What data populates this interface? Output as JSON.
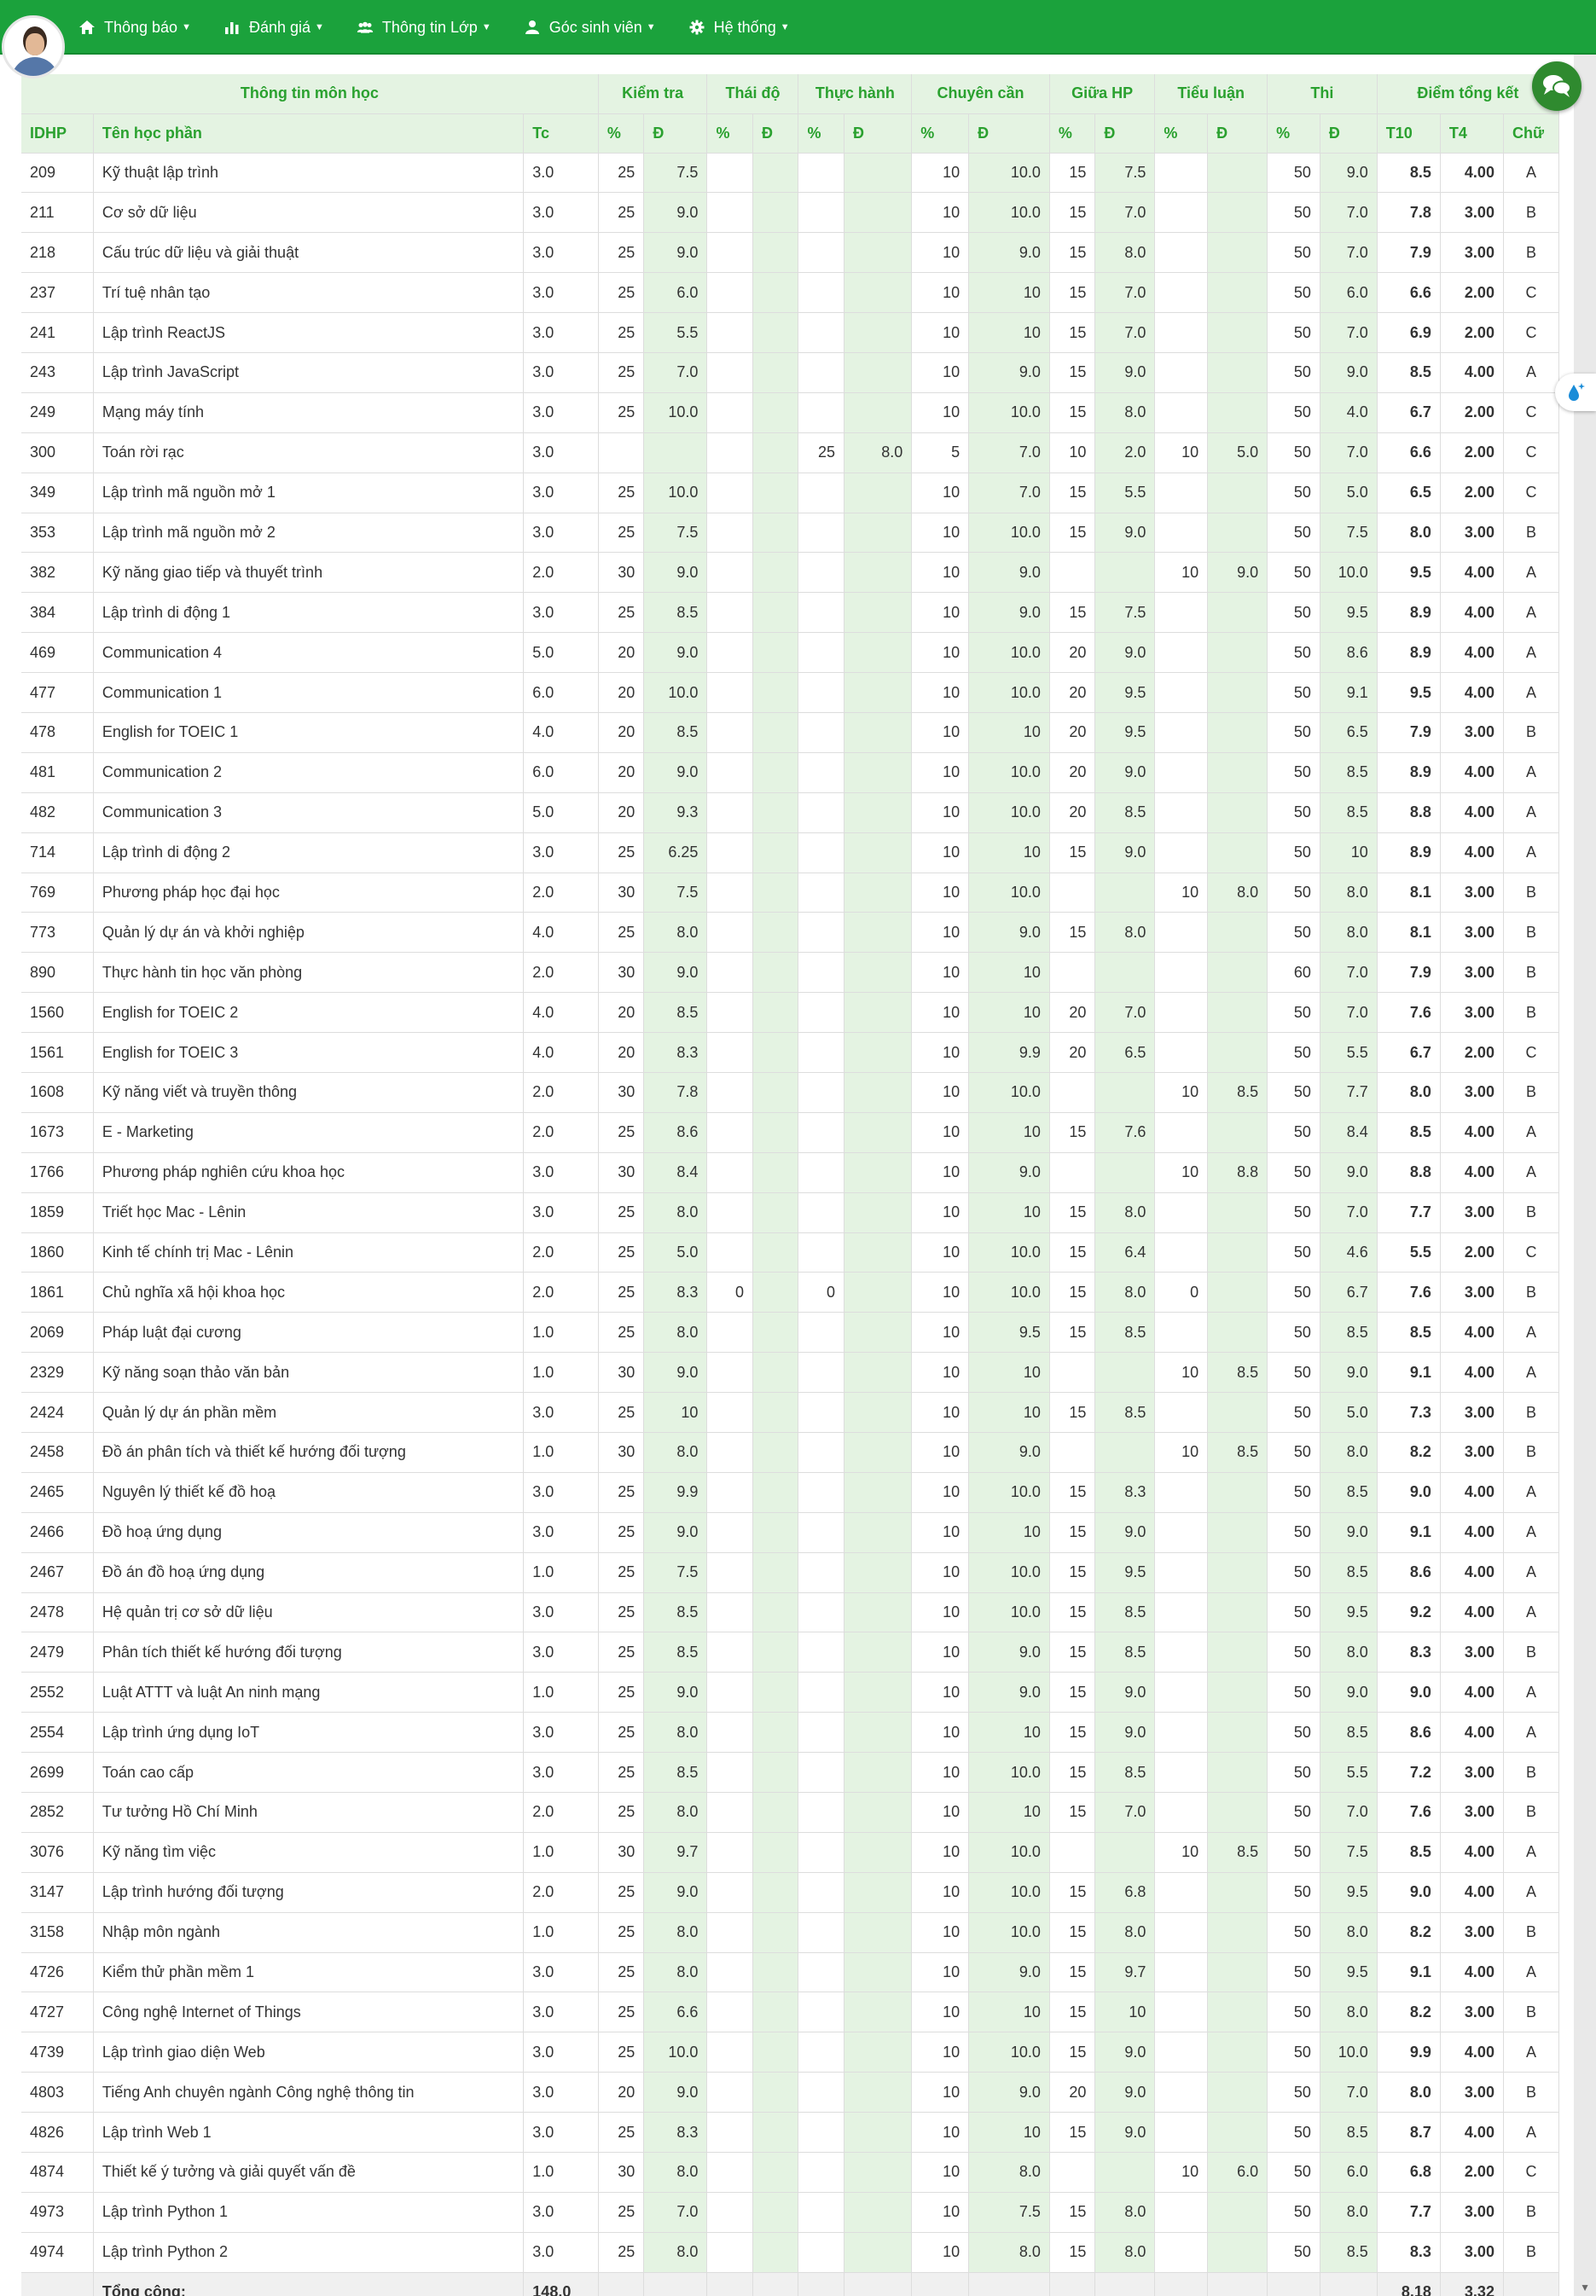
{
  "nav": {
    "items": [
      {
        "label": "Thông báo",
        "icon": "home-icon"
      },
      {
        "label": "Đánh giá",
        "icon": "bar-chart-icon"
      },
      {
        "label": "Thông tin Lớp",
        "icon": "users-icon"
      },
      {
        "label": "Góc sinh viên",
        "icon": "user-icon"
      },
      {
        "label": "Hệ thống",
        "icon": "gear-icon"
      }
    ]
  },
  "table": {
    "groups": [
      "Thông tin môn học",
      "Kiểm tra",
      "Thái độ",
      "Thực hành",
      "Chuyên cần",
      "Giữa HP",
      "Tiểu luận",
      "Thi",
      "Điểm tổng kết"
    ],
    "columns": [
      "IDHP",
      "Tên học phần",
      "Tc",
      "%",
      "Đ",
      "%",
      "Đ",
      "%",
      "Đ",
      "%",
      "Đ",
      "%",
      "Đ",
      "%",
      "Đ",
      "%",
      "Đ",
      "T10",
      "T4",
      "Chữ"
    ],
    "rows": [
      [
        "209",
        "Kỹ thuật lập trình",
        "3.0",
        "25",
        "7.5",
        "",
        "",
        "",
        "",
        "10",
        "10.0",
        "15",
        "7.5",
        "",
        "",
        "50",
        "9.0",
        "8.5",
        "4.00",
        "A"
      ],
      [
        "211",
        "Cơ sở dữ liệu",
        "3.0",
        "25",
        "9.0",
        "",
        "",
        "",
        "",
        "10",
        "10.0",
        "15",
        "7.0",
        "",
        "",
        "50",
        "7.0",
        "7.8",
        "3.00",
        "B"
      ],
      [
        "218",
        "Cấu trúc dữ liệu và giải thuật",
        "3.0",
        "25",
        "9.0",
        "",
        "",
        "",
        "",
        "10",
        "9.0",
        "15",
        "8.0",
        "",
        "",
        "50",
        "7.0",
        "7.9",
        "3.00",
        "B"
      ],
      [
        "237",
        "Trí tuệ nhân tạo",
        "3.0",
        "25",
        "6.0",
        "",
        "",
        "",
        "",
        "10",
        "10",
        "15",
        "7.0",
        "",
        "",
        "50",
        "6.0",
        "6.6",
        "2.00",
        "C"
      ],
      [
        "241",
        "Lập trình ReactJS",
        "3.0",
        "25",
        "5.5",
        "",
        "",
        "",
        "",
        "10",
        "10",
        "15",
        "7.0",
        "",
        "",
        "50",
        "7.0",
        "6.9",
        "2.00",
        "C"
      ],
      [
        "243",
        "Lập trình JavaScript",
        "3.0",
        "25",
        "7.0",
        "",
        "",
        "",
        "",
        "10",
        "9.0",
        "15",
        "9.0",
        "",
        "",
        "50",
        "9.0",
        "8.5",
        "4.00",
        "A"
      ],
      [
        "249",
        "Mạng máy tính",
        "3.0",
        "25",
        "10.0",
        "",
        "",
        "",
        "",
        "10",
        "10.0",
        "15",
        "8.0",
        "",
        "",
        "50",
        "4.0",
        "6.7",
        "2.00",
        "C"
      ],
      [
        "300",
        "Toán rời rạc",
        "3.0",
        "",
        "",
        "",
        "",
        "25",
        "8.0",
        "5",
        "7.0",
        "10",
        "2.0",
        "10",
        "5.0",
        "50",
        "7.0",
        "6.6",
        "2.00",
        "C"
      ],
      [
        "349",
        "Lập trình mã nguồn mở 1",
        "3.0",
        "25",
        "10.0",
        "",
        "",
        "",
        "",
        "10",
        "7.0",
        "15",
        "5.5",
        "",
        "",
        "50",
        "5.0",
        "6.5",
        "2.00",
        "C"
      ],
      [
        "353",
        "Lập trình mã nguồn mở 2",
        "3.0",
        "25",
        "7.5",
        "",
        "",
        "",
        "",
        "10",
        "10.0",
        "15",
        "9.0",
        "",
        "",
        "50",
        "7.5",
        "8.0",
        "3.00",
        "B"
      ],
      [
        "382",
        "Kỹ năng giao tiếp và thuyết trình",
        "2.0",
        "30",
        "9.0",
        "",
        "",
        "",
        "",
        "10",
        "9.0",
        "",
        "",
        "10",
        "9.0",
        "50",
        "10.0",
        "9.5",
        "4.00",
        "A"
      ],
      [
        "384",
        "Lập trình di động 1",
        "3.0",
        "25",
        "8.5",
        "",
        "",
        "",
        "",
        "10",
        "9.0",
        "15",
        "7.5",
        "",
        "",
        "50",
        "9.5",
        "8.9",
        "4.00",
        "A"
      ],
      [
        "469",
        "Communication 4",
        "5.0",
        "20",
        "9.0",
        "",
        "",
        "",
        "",
        "10",
        "10.0",
        "20",
        "9.0",
        "",
        "",
        "50",
        "8.6",
        "8.9",
        "4.00",
        "A"
      ],
      [
        "477",
        "Communication 1",
        "6.0",
        "20",
        "10.0",
        "",
        "",
        "",
        "",
        "10",
        "10.0",
        "20",
        "9.5",
        "",
        "",
        "50",
        "9.1",
        "9.5",
        "4.00",
        "A"
      ],
      [
        "478",
        "English for TOEIC 1",
        "4.0",
        "20",
        "8.5",
        "",
        "",
        "",
        "",
        "10",
        "10",
        "20",
        "9.5",
        "",
        "",
        "50",
        "6.5",
        "7.9",
        "3.00",
        "B"
      ],
      [
        "481",
        "Communication 2",
        "6.0",
        "20",
        "9.0",
        "",
        "",
        "",
        "",
        "10",
        "10.0",
        "20",
        "9.0",
        "",
        "",
        "50",
        "8.5",
        "8.9",
        "4.00",
        "A"
      ],
      [
        "482",
        "Communication 3",
        "5.0",
        "20",
        "9.3",
        "",
        "",
        "",
        "",
        "10",
        "10.0",
        "20",
        "8.5",
        "",
        "",
        "50",
        "8.5",
        "8.8",
        "4.00",
        "A"
      ],
      [
        "714",
        "Lập trình di động 2",
        "3.0",
        "25",
        "6.25",
        "",
        "",
        "",
        "",
        "10",
        "10",
        "15",
        "9.0",
        "",
        "",
        "50",
        "10",
        "8.9",
        "4.00",
        "A"
      ],
      [
        "769",
        "Phương pháp học đại học",
        "2.0",
        "30",
        "7.5",
        "",
        "",
        "",
        "",
        "10",
        "10.0",
        "",
        "",
        "10",
        "8.0",
        "50",
        "8.0",
        "8.1",
        "3.00",
        "B"
      ],
      [
        "773",
        "Quản lý dự án và khởi nghiệp",
        "4.0",
        "25",
        "8.0",
        "",
        "",
        "",
        "",
        "10",
        "9.0",
        "15",
        "8.0",
        "",
        "",
        "50",
        "8.0",
        "8.1",
        "3.00",
        "B"
      ],
      [
        "890",
        "Thực hành tin học văn phòng",
        "2.0",
        "30",
        "9.0",
        "",
        "",
        "",
        "",
        "10",
        "10",
        "",
        "",
        "",
        "",
        "60",
        "7.0",
        "7.9",
        "3.00",
        "B"
      ],
      [
        "1560",
        "English for TOEIC 2",
        "4.0",
        "20",
        "8.5",
        "",
        "",
        "",
        "",
        "10",
        "10",
        "20",
        "7.0",
        "",
        "",
        "50",
        "7.0",
        "7.6",
        "3.00",
        "B"
      ],
      [
        "1561",
        "English for TOEIC 3",
        "4.0",
        "20",
        "8.3",
        "",
        "",
        "",
        "",
        "10",
        "9.9",
        "20",
        "6.5",
        "",
        "",
        "50",
        "5.5",
        "6.7",
        "2.00",
        "C"
      ],
      [
        "1608",
        "Kỹ năng viết và truyền thông",
        "2.0",
        "30",
        "7.8",
        "",
        "",
        "",
        "",
        "10",
        "10.0",
        "",
        "",
        "10",
        "8.5",
        "50",
        "7.7",
        "8.0",
        "3.00",
        "B"
      ],
      [
        "1673",
        "E - Marketing",
        "2.0",
        "25",
        "8.6",
        "",
        "",
        "",
        "",
        "10",
        "10",
        "15",
        "7.6",
        "",
        "",
        "50",
        "8.4",
        "8.5",
        "4.00",
        "A"
      ],
      [
        "1766",
        "Phương pháp nghiên cứu khoa học",
        "3.0",
        "30",
        "8.4",
        "",
        "",
        "",
        "",
        "10",
        "9.0",
        "",
        "",
        "10",
        "8.8",
        "50",
        "9.0",
        "8.8",
        "4.00",
        "A"
      ],
      [
        "1859",
        "Triết học Mac - Lênin",
        "3.0",
        "25",
        "8.0",
        "",
        "",
        "",
        "",
        "10",
        "10",
        "15",
        "8.0",
        "",
        "",
        "50",
        "7.0",
        "7.7",
        "3.00",
        "B"
      ],
      [
        "1860",
        "Kinh tế chính trị Mac - Lênin",
        "2.0",
        "25",
        "5.0",
        "",
        "",
        "",
        "",
        "10",
        "10.0",
        "15",
        "6.4",
        "",
        "",
        "50",
        "4.6",
        "5.5",
        "2.00",
        "C"
      ],
      [
        "1861",
        "Chủ nghĩa xã hội khoa học",
        "2.0",
        "25",
        "8.3",
        "0",
        "",
        "0",
        "",
        "10",
        "10.0",
        "15",
        "8.0",
        "0",
        "",
        "50",
        "6.7",
        "7.6",
        "3.00",
        "B"
      ],
      [
        "2069",
        "Pháp luật đại cương",
        "1.0",
        "25",
        "8.0",
        "",
        "",
        "",
        "",
        "10",
        "9.5",
        "15",
        "8.5",
        "",
        "",
        "50",
        "8.5",
        "8.5",
        "4.00",
        "A"
      ],
      [
        "2329",
        "Kỹ năng soạn thảo văn bản",
        "1.0",
        "30",
        "9.0",
        "",
        "",
        "",
        "",
        "10",
        "10",
        "",
        "",
        "10",
        "8.5",
        "50",
        "9.0",
        "9.1",
        "4.00",
        "A"
      ],
      [
        "2424",
        "Quản lý dự án phần mềm",
        "3.0",
        "25",
        "10",
        "",
        "",
        "",
        "",
        "10",
        "10",
        "15",
        "8.5",
        "",
        "",
        "50",
        "5.0",
        "7.3",
        "3.00",
        "B"
      ],
      [
        "2458",
        "Đồ án phân tích và thiết kế hướng đối tượng",
        "1.0",
        "30",
        "8.0",
        "",
        "",
        "",
        "",
        "10",
        "9.0",
        "",
        "",
        "10",
        "8.5",
        "50",
        "8.0",
        "8.2",
        "3.00",
        "B"
      ],
      [
        "2465",
        "Nguyên lý thiết kế đồ hoạ",
        "3.0",
        "25",
        "9.9",
        "",
        "",
        "",
        "",
        "10",
        "10.0",
        "15",
        "8.3",
        "",
        "",
        "50",
        "8.5",
        "9.0",
        "4.00",
        "A"
      ],
      [
        "2466",
        "Đồ hoạ ứng dụng",
        "3.0",
        "25",
        "9.0",
        "",
        "",
        "",
        "",
        "10",
        "10",
        "15",
        "9.0",
        "",
        "",
        "50",
        "9.0",
        "9.1",
        "4.00",
        "A"
      ],
      [
        "2467",
        "Đồ án đồ hoạ ứng dụng",
        "1.0",
        "25",
        "7.5",
        "",
        "",
        "",
        "",
        "10",
        "10.0",
        "15",
        "9.5",
        "",
        "",
        "50",
        "8.5",
        "8.6",
        "4.00",
        "A"
      ],
      [
        "2478",
        "Hệ quản trị cơ sở dữ liệu",
        "3.0",
        "25",
        "8.5",
        "",
        "",
        "",
        "",
        "10",
        "10.0",
        "15",
        "8.5",
        "",
        "",
        "50",
        "9.5",
        "9.2",
        "4.00",
        "A"
      ],
      [
        "2479",
        "Phân tích thiết kế hướng đối tượng",
        "3.0",
        "25",
        "8.5",
        "",
        "",
        "",
        "",
        "10",
        "9.0",
        "15",
        "8.5",
        "",
        "",
        "50",
        "8.0",
        "8.3",
        "3.00",
        "B"
      ],
      [
        "2552",
        "Luật ATTT và luật An ninh mạng",
        "1.0",
        "25",
        "9.0",
        "",
        "",
        "",
        "",
        "10",
        "9.0",
        "15",
        "9.0",
        "",
        "",
        "50",
        "9.0",
        "9.0",
        "4.00",
        "A"
      ],
      [
        "2554",
        "Lập trình ứng dụng IoT",
        "3.0",
        "25",
        "8.0",
        "",
        "",
        "",
        "",
        "10",
        "10",
        "15",
        "9.0",
        "",
        "",
        "50",
        "8.5",
        "8.6",
        "4.00",
        "A"
      ],
      [
        "2699",
        "Toán cao cấp",
        "3.0",
        "25",
        "8.5",
        "",
        "",
        "",
        "",
        "10",
        "10.0",
        "15",
        "8.5",
        "",
        "",
        "50",
        "5.5",
        "7.2",
        "3.00",
        "B"
      ],
      [
        "2852",
        "Tư tưởng Hồ Chí Minh",
        "2.0",
        "25",
        "8.0",
        "",
        "",
        "",
        "",
        "10",
        "10",
        "15",
        "7.0",
        "",
        "",
        "50",
        "7.0",
        "7.6",
        "3.00",
        "B"
      ],
      [
        "3076",
        "Kỹ năng tìm việc",
        "1.0",
        "30",
        "9.7",
        "",
        "",
        "",
        "",
        "10",
        "10.0",
        "",
        "",
        "10",
        "8.5",
        "50",
        "7.5",
        "8.5",
        "4.00",
        "A"
      ],
      [
        "3147",
        "Lập trình hướng đối tượng",
        "2.0",
        "25",
        "9.0",
        "",
        "",
        "",
        "",
        "10",
        "10.0",
        "15",
        "6.8",
        "",
        "",
        "50",
        "9.5",
        "9.0",
        "4.00",
        "A"
      ],
      [
        "3158",
        "Nhập môn ngành",
        "1.0",
        "25",
        "8.0",
        "",
        "",
        "",
        "",
        "10",
        "10.0",
        "15",
        "8.0",
        "",
        "",
        "50",
        "8.0",
        "8.2",
        "3.00",
        "B"
      ],
      [
        "4726",
        "Kiểm thử phần mềm 1",
        "3.0",
        "25",
        "8.0",
        "",
        "",
        "",
        "",
        "10",
        "9.0",
        "15",
        "9.7",
        "",
        "",
        "50",
        "9.5",
        "9.1",
        "4.00",
        "A"
      ],
      [
        "4727",
        "Công nghệ Internet of Things",
        "3.0",
        "25",
        "6.6",
        "",
        "",
        "",
        "",
        "10",
        "10",
        "15",
        "10",
        "",
        "",
        "50",
        "8.0",
        "8.2",
        "3.00",
        "B"
      ],
      [
        "4739",
        "Lập trình giao diện Web",
        "3.0",
        "25",
        "10.0",
        "",
        "",
        "",
        "",
        "10",
        "10.0",
        "15",
        "9.0",
        "",
        "",
        "50",
        "10.0",
        "9.9",
        "4.00",
        "A"
      ],
      [
        "4803",
        "Tiếng Anh chuyên ngành Công nghệ thông tin",
        "3.0",
        "20",
        "9.0",
        "",
        "",
        "",
        "",
        "10",
        "9.0",
        "20",
        "9.0",
        "",
        "",
        "50",
        "7.0",
        "8.0",
        "3.00",
        "B"
      ],
      [
        "4826",
        "Lập trình Web 1",
        "3.0",
        "25",
        "8.3",
        "",
        "",
        "",
        "",
        "10",
        "10",
        "15",
        "9.0",
        "",
        "",
        "50",
        "8.5",
        "8.7",
        "4.00",
        "A"
      ],
      [
        "4874",
        "Thiết kế ý tưởng và giải quyết vấn đề",
        "1.0",
        "30",
        "8.0",
        "",
        "",
        "",
        "",
        "10",
        "8.0",
        "",
        "",
        "10",
        "6.0",
        "50",
        "6.0",
        "6.8",
        "2.00",
        "C"
      ],
      [
        "4973",
        "Lập trình Python 1",
        "3.0",
        "25",
        "7.0",
        "",
        "",
        "",
        "",
        "10",
        "7.5",
        "15",
        "8.0",
        "",
        "",
        "50",
        "8.0",
        "7.7",
        "3.00",
        "B"
      ],
      [
        "4974",
        "Lập trình Python 2",
        "3.0",
        "25",
        "8.0",
        "",
        "",
        "",
        "",
        "10",
        "8.0",
        "15",
        "8.0",
        "",
        "",
        "50",
        "8.5",
        "8.3",
        "3.00",
        "B"
      ]
    ],
    "total": {
      "label": "Tổng cộng:",
      "tc": "148.0",
      "t10": "8.18",
      "t4": "3.32"
    }
  }
}
